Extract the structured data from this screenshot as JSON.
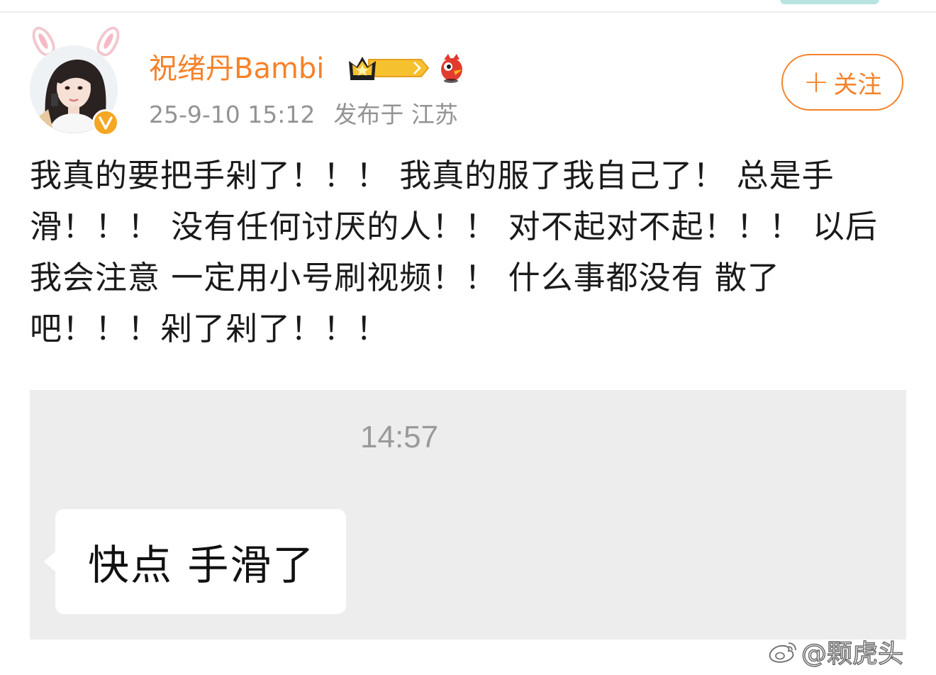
{
  "post": {
    "author": {
      "name": "祝绪丹Bambi",
      "verified": true,
      "crown_level": "I",
      "accent_color": "#f5822a"
    },
    "time": "25-9-10 15:12",
    "location": "发布于 江苏",
    "follow_label": "关注",
    "text": "我真的要把手剁了！！！ 我真的服了我自己了！ 总是手滑！！！ 没有任何讨厌的人！！ 对不起对不起！！！ 以后我会注意 一定用小号刷视频！！ 什么事都没有 散了吧！！！剁了剁了！！！"
  },
  "embed": {
    "time": "14:57",
    "bubble_text": "快点 手滑了",
    "background_color": "#ededed"
  },
  "watermark": {
    "text": "@颗虎头"
  }
}
